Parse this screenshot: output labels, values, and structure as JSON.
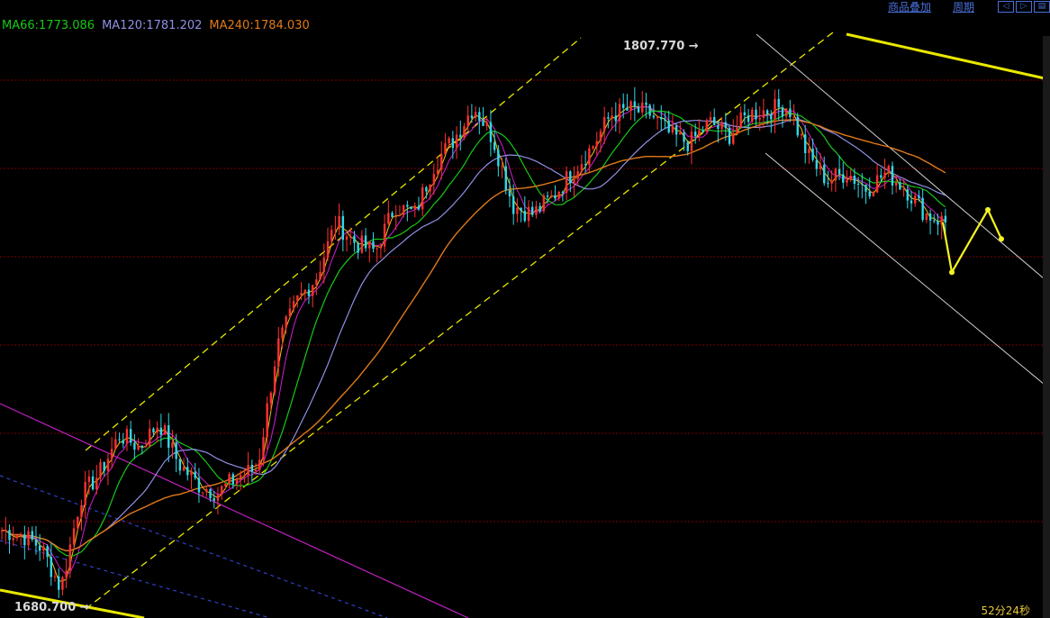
{
  "toolbar": {
    "overlay_label": "商品叠加",
    "period_label": "周期",
    "prev_icon": "arrow-left-icon",
    "next_icon": "arrow-right-icon",
    "layout_icon": "layout-icon"
  },
  "legend": {
    "ma66": "MA66:1773.086",
    "ma120": "MA120:1781.202",
    "ma240": "MA240:1784.030"
  },
  "colors": {
    "ma66": "#17c917",
    "ma120": "#8f8fe6",
    "ma240": "#e07a1a",
    "ma_short1": "#e8c31a",
    "ma_short2": "#d020d0",
    "candle_up": "#ff3030",
    "candle_down": "#30d8e8",
    "channel": "#e8e800",
    "down_channel": "#d0d0d0",
    "blue_channel": "#3040c0",
    "magenta_channel": "#c020c0",
    "grid": "#7a0000"
  },
  "annotations": {
    "high_label": "1807.770",
    "low_label": "1680.700"
  },
  "timer": "52分24秒",
  "chart_data": {
    "type": "candlestick",
    "y_range": [
      1678,
      1813
    ],
    "high": 1807.77,
    "low": 1680.7,
    "moving_averages": [
      {
        "name": "MA66",
        "last": 1773.086
      },
      {
        "name": "MA120",
        "last": 1781.202
      },
      {
        "name": "MA240",
        "last": 1784.03
      }
    ],
    "price_path": [
      1696,
      1695,
      1692,
      1682,
      1704,
      1710,
      1719,
      1716,
      1722,
      1712,
      1707,
      1705,
      1709,
      1711,
      1740,
      1751,
      1757,
      1770,
      1765,
      1763,
      1774,
      1772,
      1784,
      1790,
      1798,
      1790,
      1774,
      1772,
      1776,
      1782,
      1788,
      1796,
      1797,
      1796,
      1791,
      1789,
      1794,
      1791,
      1796,
      1797,
      1798,
      1786,
      1780,
      1782,
      1778,
      1782,
      1778,
      1772,
      1770
    ],
    "forecast_path": [
      1770,
      1758,
      1773,
      1766
    ]
  }
}
